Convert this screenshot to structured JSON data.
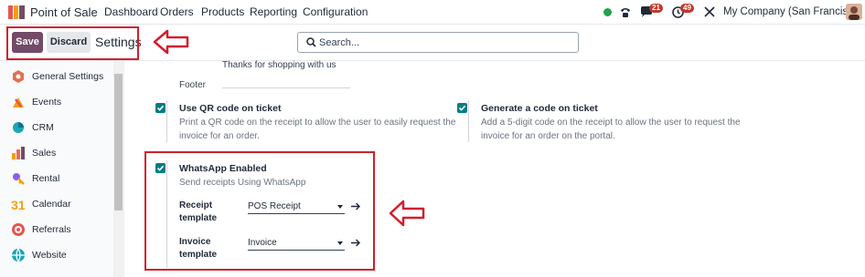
{
  "navbar": {
    "app_name": "Point of Sale",
    "menu": [
      "Dashboard",
      "Orders",
      "Products",
      "Reporting",
      "Configuration"
    ],
    "messages_count": "21",
    "activities_count": "49",
    "company": "My Company (San Francisco)"
  },
  "control": {
    "save_label": "Save",
    "discard_label": "Discard",
    "title": "Settings",
    "search_placeholder": "Search..."
  },
  "sidebar": {
    "items": [
      {
        "label": "General Settings",
        "icon": "general-settings-icon",
        "color": "#e46f4e"
      },
      {
        "label": "Events",
        "icon": "events-icon",
        "color": "#f59e0b"
      },
      {
        "label": "CRM",
        "icon": "crm-icon",
        "color": "#1aa6b7"
      },
      {
        "label": "Sales",
        "icon": "sales-icon",
        "color": "#e46f4e"
      },
      {
        "label": "Rental",
        "icon": "rental-icon",
        "color": "#8b5cf6"
      },
      {
        "label": "Calendar",
        "icon": "calendar-icon",
        "color": "#f59e0b"
      },
      {
        "label": "Referrals",
        "icon": "referrals-icon",
        "color": "#e4564e"
      },
      {
        "label": "Website",
        "icon": "website-icon",
        "color": "#1aa6b7"
      }
    ]
  },
  "content": {
    "footer_text": "Thanks for shopping with us",
    "footer_label": "Footer",
    "qr_title": "Use QR code on ticket",
    "qr_desc": "Print a QR code on the receipt to allow the user to easily request the invoice for an order.",
    "code_title": "Generate a code on ticket",
    "code_desc": "Add a 5-digit code on the receipt to allow the user to request the invoice for an order on the portal.",
    "whatsapp_title": "WhatsApp Enabled",
    "whatsapp_desc": "Send receipts Using WhatsApp",
    "receipt_label": "Receipt template",
    "receipt_value": "POS Receipt",
    "invoice_label": "Invoice template",
    "invoice_value": "Invoice"
  },
  "colors": {
    "brand": "#714b67",
    "checkbox": "#017e84",
    "highlight": "#d11f2c"
  }
}
